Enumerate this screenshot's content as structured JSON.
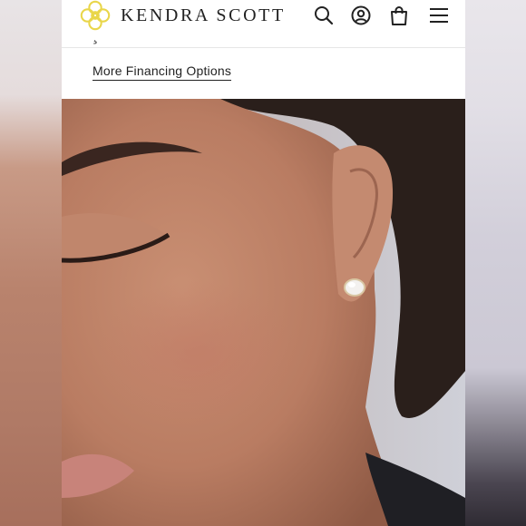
{
  "header": {
    "brand_name": "KENDRA SCOTT",
    "logo_icon": "kendra-scott-flower-logo-icon",
    "icons": [
      "search-icon",
      "account-icon",
      "shopping-bag-icon",
      "menu-icon"
    ],
    "accent_color": "#e9d64a"
  },
  "main": {
    "cut_off_text": "¸",
    "financing_link": "More Financing Options",
    "product_image": {
      "subject": "model-wearing-stud-earring",
      "background_color": "#cdced6"
    }
  }
}
